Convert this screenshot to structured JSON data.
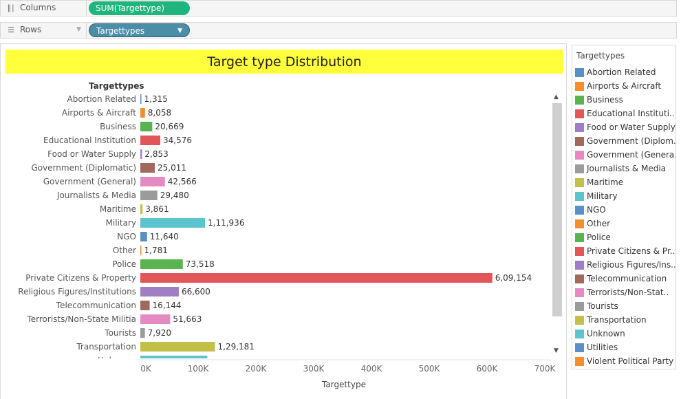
{
  "shelves": {
    "columns": {
      "label": "Columns",
      "pill": "SUM(Targettype)"
    },
    "rows": {
      "label": "Rows",
      "pill": "Targettypes"
    }
  },
  "chart_data": {
    "type": "bar",
    "orientation": "horizontal",
    "title": "Target type Distribution",
    "row_header": "Targettypes",
    "xlabel": "Targettype",
    "xlim": [
      0,
      700000
    ],
    "x_ticks": [
      "0K",
      "100K",
      "200K",
      "300K",
      "400K",
      "500K",
      "600K",
      "700K"
    ],
    "categories": [
      "Abortion Related",
      "Airports & Aircraft",
      "Business",
      "Educational Institution",
      "Food or Water Supply",
      "Government (Diplomatic)",
      "Government (General)",
      "Journalists & Media",
      "Maritime",
      "Military",
      "NGO",
      "Other",
      "Police",
      "Private Citizens & Property",
      "Religious Figures/Institutions",
      "Telecommunication",
      "Terrorists/Non-State Militia",
      "Tourists",
      "Transportation",
      "Unknown"
    ],
    "values": [
      1315,
      8058,
      20669,
      34576,
      2853,
      25011,
      42566,
      29480,
      3861,
      111936,
      11640,
      1781,
      73518,
      609154,
      66600,
      16144,
      51663,
      7920,
      129181,
      116000
    ],
    "value_labels": [
      "1,315",
      "8,058",
      "20,669",
      "34,576",
      "2,853",
      "25,011",
      "42,566",
      "29,480",
      "3,861",
      "1,11,936",
      "11,640",
      "1,781",
      "73,518",
      "6,09,154",
      "66,600",
      "16,144",
      "51,663",
      "7,920",
      "1,29,181",
      ""
    ],
    "colors": [
      "#5b8fc7",
      "#f28e2b",
      "#59b34f",
      "#e15759",
      "#a07ec6",
      "#a0695c",
      "#e68ac3",
      "#9b9b9b",
      "#c2c04a",
      "#5cc3cf",
      "#5b8fc7",
      "#f28e2b",
      "#59b34f",
      "#e15759",
      "#a07ec6",
      "#a0695c",
      "#e68ac3",
      "#9b9b9b",
      "#c2c04a",
      "#5cc3cf"
    ],
    "grid": false
  },
  "legend": {
    "title": "Targettypes",
    "items": [
      {
        "label": "Abortion Related",
        "color": "#5b8fc7"
      },
      {
        "label": "Airports & Aircraft",
        "color": "#f28e2b"
      },
      {
        "label": "Business",
        "color": "#59b34f"
      },
      {
        "label": "Educational Instituti..",
        "color": "#e15759"
      },
      {
        "label": "Food or Water Supply",
        "color": "#a07ec6"
      },
      {
        "label": "Government (Diplom..",
        "color": "#a0695c"
      },
      {
        "label": "Government (Genera..",
        "color": "#e68ac3"
      },
      {
        "label": "Journalists & Media",
        "color": "#9b9b9b"
      },
      {
        "label": "Maritime",
        "color": "#c2c04a"
      },
      {
        "label": "Military",
        "color": "#5cc3cf"
      },
      {
        "label": "NGO",
        "color": "#5b8fc7"
      },
      {
        "label": "Other",
        "color": "#f28e2b"
      },
      {
        "label": "Police",
        "color": "#59b34f"
      },
      {
        "label": "Private Citizens & Pr..",
        "color": "#e15759"
      },
      {
        "label": "Religious Figures/Ins..",
        "color": "#a07ec6"
      },
      {
        "label": "Telecommunication",
        "color": "#a0695c"
      },
      {
        "label": "Terrorists/Non-Stat..",
        "color": "#e68ac3"
      },
      {
        "label": "Tourists",
        "color": "#9b9b9b"
      },
      {
        "label": "Transportation",
        "color": "#c2c04a"
      },
      {
        "label": "Unknown",
        "color": "#5cc3cf"
      },
      {
        "label": "Utilities",
        "color": "#5b8fc7"
      },
      {
        "label": "Violent Political Party",
        "color": "#f28e2b"
      }
    ]
  }
}
